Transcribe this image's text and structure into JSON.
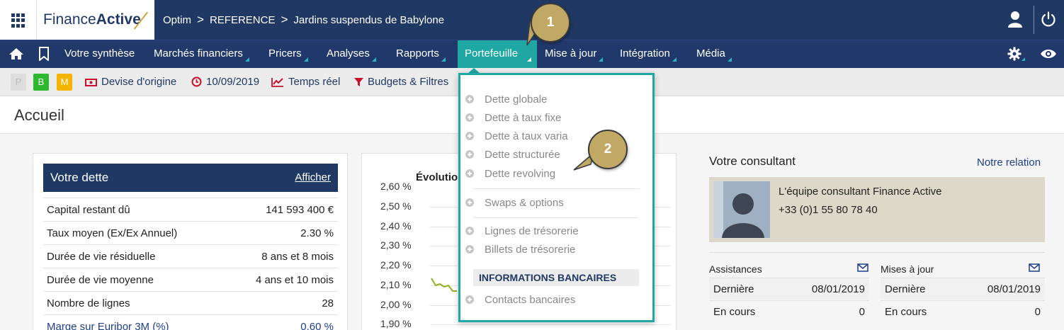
{
  "topbar": {
    "logo_regular": "Finance",
    "logo_bold": "Active",
    "breadcrumb": [
      "Optim",
      "REFERENCE",
      "Jardins suspendus de Babylone"
    ],
    "icons": [
      "apps-grid-icon",
      "user-icon",
      "power-icon"
    ]
  },
  "nav": {
    "items": [
      "Votre synthèse",
      "Marchés financiers",
      "Pricers",
      "Analyses",
      "Rapports",
      "Portefeuille",
      "Mise à jour",
      "Intégration",
      "Média"
    ],
    "active": "Portefeuille",
    "icons": [
      "home-icon",
      "bookmark-icon",
      "gear-icon",
      "eye-icon"
    ],
    "accent": "#1fa7a3"
  },
  "toolbar": {
    "pills": [
      "P",
      "B",
      "M"
    ],
    "devise": "Devise d'origine",
    "date": "10/09/2019",
    "temps_reel": "Temps réel",
    "budgets": "Budgets & Filtres"
  },
  "page": {
    "title": "Accueil"
  },
  "dette": {
    "title": "Votre dette",
    "action": "Afficher",
    "rows": [
      {
        "label": "Capital restant dû",
        "value": "141 593 400 €"
      },
      {
        "label": "Taux moyen (Ex/Ex Annuel)",
        "value": "2.30 %"
      },
      {
        "label": "Durée de vie résiduelle",
        "value": "8 ans et 8 mois"
      },
      {
        "label": "Durée de vie moyenne",
        "value": "4 ans et 10 mois"
      },
      {
        "label": "Nombre de lignes",
        "value": "28"
      },
      {
        "label": "Marge sur Euribor 3M (%)",
        "value": "0,60 %"
      }
    ]
  },
  "chart": {
    "title": "Évolutio",
    "yticks": [
      "2,60 %",
      "2,50 %",
      "2,40 %",
      "2,30 %",
      "2,20 %",
      "2,10 %",
      "2,00 %",
      "1,90 %"
    ]
  },
  "consultant": {
    "title": "Votre consultant",
    "link": "Notre relation",
    "name": "L'équipe consultant Finance Active",
    "phone": "+33 (0)1 55 80 78 40",
    "assistances": {
      "title": "Assistances",
      "rows": [
        {
          "label": "Dernière",
          "value": "08/01/2019"
        },
        {
          "label": "En cours",
          "value": "0"
        }
      ]
    },
    "mises_a_jour": {
      "title": "Mises à jour",
      "rows": [
        {
          "label": "Dernière",
          "value": "08/01/2019"
        },
        {
          "label": "En cours",
          "value": "0"
        }
      ]
    }
  },
  "dropdown": {
    "group1": [
      "Dette globale",
      "Dette à taux fixe",
      "Dette à taux varia",
      "Dette structurée",
      "Dette revolving"
    ],
    "group2": [
      "Swaps & options"
    ],
    "group3": [
      "Lignes de trésorerie",
      "Billets de trésorerie"
    ],
    "section_header": "INFORMATIONS BANCAIRES",
    "group4": [
      "Contacts bancaires"
    ]
  },
  "markers": [
    "1",
    "2"
  ]
}
